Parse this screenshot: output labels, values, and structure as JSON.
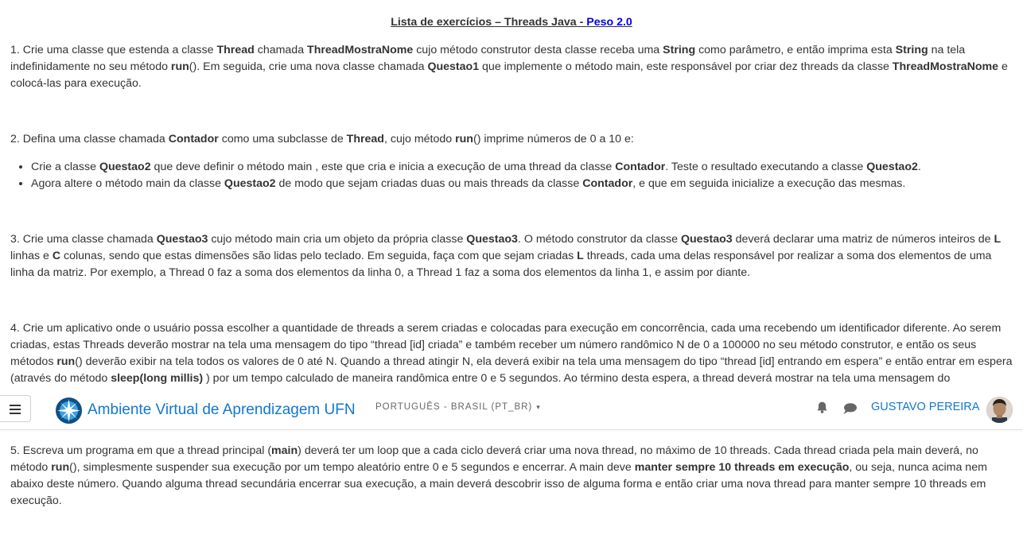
{
  "doc": {
    "title_main": "Lista de exercícios – Threads Java - ",
    "title_peso": "Peso 2.0",
    "q1": {
      "t1": "1. Crie uma classe que estenda a classe ",
      "b1": "Thread",
      "t2": " chamada ",
      "b2": "ThreadMostraNome",
      "t3": " cujo método construtor desta classe receba uma ",
      "b3": "String",
      "t4": " como parâmetro, e então imprima esta ",
      "b4": "String",
      "t5": " na tela indefinidamente no seu método ",
      "b5": "run",
      "t6": "(). Em seguida, crie uma nova classe chamada ",
      "b6": "Questao1",
      "t7": " que implemente o método main, este responsável por criar dez  threads da classe ",
      "b7": "ThreadMostraNome",
      "t8": " e colocá-las para execução."
    },
    "q2": {
      "t1": "2. Defina uma classe chamada ",
      "b1": "Contador",
      "t2": " como uma subclasse de ",
      "b2": "Thread",
      "t3": ", cujo método ",
      "b3": "run",
      "t4": "() imprime números de 0 a 10 e:",
      "li1": {
        "t1": "Crie a classe ",
        "b1": "Questao2",
        "t2": " que deve definir o método main , este que cria e inicia a execução de uma thread da classe ",
        "b2": "Contador",
        "t3": ". Teste o resultado executando a classe ",
        "b3": "Questao2",
        "t4": "."
      },
      "li2": {
        "t1": "Agora altere o método main da classe ",
        "b1": "Questao2",
        "t2": " de modo que sejam criadas duas ou mais threads da classe ",
        "b2": "Contador",
        "t3": ", e que em seguida inicialize a execução das mesmas."
      }
    },
    "q3": {
      "t1": "3. Crie uma classe chamada ",
      "b1": "Questao3",
      "t2": " cujo método main cria um objeto da própria classe ",
      "b2": "Questao3",
      "t3": ". O método construtor da classe ",
      "b3": "Questao3",
      "t4": " deverá declarar uma matriz de números inteiros de ",
      "b4": "L",
      "t5": " linhas e ",
      "b5": "C",
      "t6": " colunas, sendo que estas dimensões são lidas pelo teclado. Em seguida, faça com que sejam criadas ",
      "b6": "L",
      "t7": " threads, cada uma delas responsável por realizar a soma dos elementos de uma linha da matriz. Por exemplo, a Thread 0 faz a soma dos elementos da linha 0, a Thread 1 faz a soma dos elementos da linha 1, e assim por diante."
    },
    "q4": {
      "t1": "4. Crie um aplicativo onde o usuário possa escolher a quantidade de threads a serem criadas e colocadas para execução em concorrência, cada uma recebendo um identificador diferente. Ao serem criadas, estas Threads deverão mostrar na tela uma mensagem do tipo “thread [id] criada” e também receber um número randômico N de 0 a 100000 no seu método construtor, e então os seus métodos ",
      "b1": "run",
      "t2": "() deverão exibir na tela todos os valores de 0 até N. Quando a thread atingir N, ela deverá exibir na tela uma mensagem do tipo “thread [id] entrando em espera” e então entrar em espera (através do método ",
      "b2": "sleep(long millis)",
      "t3": " ) por um tempo calculado de maneira randômica entre 0 e 5 segundos. Ao término desta espera, a thread deverá mostrar na tela uma mensagem do"
    },
    "q5": {
      "t1": "5. Escreva um programa em que a thread principal (",
      "b1": "main",
      "t2": ") deverá ter um loop que a cada ciclo deverá criar uma nova thread, no máximo de 10 threads. Cada thread criada pela main deverá, no método ",
      "b2": "run",
      "t3": "(), simplesmente suspender sua execução por um tempo aleatório entre 0 e 5 segundos e encerrar. A main deve ",
      "b3": "manter sempre 10 threads em execução",
      "t4": ", ou seja, nunca acima nem abaixo deste número. Quando alguma thread secundária encerrar sua execução, a main deverá descobrir isso de alguma forma e então criar uma nova thread para manter sempre 10 threads em execução."
    }
  },
  "navbar": {
    "menu_icon": "hamburger-icon",
    "logo_icon": "ufn-logo-icon",
    "brand": "Ambiente Virtual de Aprendizagem UFN",
    "language": "PORTUGUÊS - BRASIL (PT_BR)",
    "language_caret": "▾",
    "notifications_icon": "bell-icon",
    "messages_icon": "chat-bubble-icon",
    "user_name": "GUSTAVO PEREIRA",
    "avatar_icon": "user-avatar"
  },
  "colors": {
    "text": "#333333",
    "link": "#0000ee",
    "brand": "#1177d1",
    "logo_dark": "#0f4f86",
    "logo_light": "#3aa0e4"
  }
}
